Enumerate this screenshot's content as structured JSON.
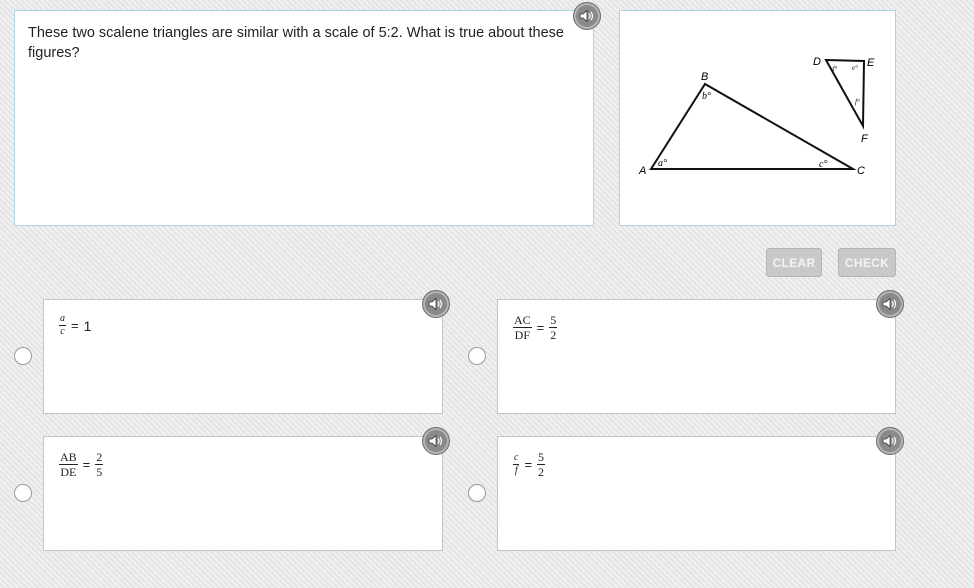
{
  "question": {
    "text": "These two scalene triangles are similar with a scale of 5:2. What is true about these figures?"
  },
  "figure": {
    "vertices": {
      "A": "A",
      "B": "B",
      "C": "C",
      "D": "D",
      "E": "E",
      "F": "F"
    },
    "angles": {
      "a": "a°",
      "b": "b°",
      "c": "c°",
      "d": "d°",
      "e": "e°",
      "f": "f°"
    }
  },
  "buttons": {
    "clear": "CLEAR",
    "check": "CHECK"
  },
  "choices": [
    {
      "num": "a",
      "den": "c",
      "eq": "=",
      "rhs": "1"
    },
    {
      "num": "AC",
      "den": "DF",
      "eq": "=",
      "rhs_num": "5",
      "rhs_den": "2"
    },
    {
      "num": "AB",
      "den": "DE",
      "eq": "=",
      "rhs_num": "2",
      "rhs_den": "5"
    },
    {
      "num": "c",
      "den": "f",
      "eq": "=",
      "rhs_num": "5",
      "rhs_den": "2"
    }
  ],
  "icons": {
    "speaker": "speaker-icon"
  }
}
